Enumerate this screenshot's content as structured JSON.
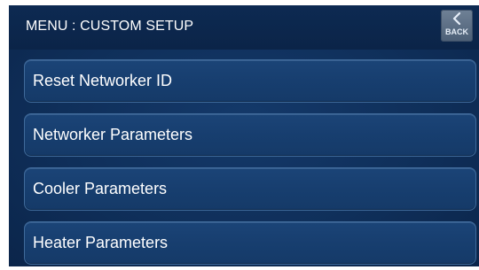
{
  "header": {
    "title": "MENU : CUSTOM SETUP",
    "back_label": "BACK",
    "back_icon": "chevron-left-icon"
  },
  "menu": {
    "items": [
      {
        "label": "Reset Networker ID"
      },
      {
        "label": "Networker Parameters"
      },
      {
        "label": "Cooler Parameters"
      },
      {
        "label": "Heater Parameters"
      }
    ]
  },
  "colors": {
    "background": "#0f2f5a",
    "header": "#0c2650",
    "item": "#173e6f",
    "item_border": "#3f6a9a",
    "back_button": "#5a6d84",
    "text": "#ffffff"
  }
}
